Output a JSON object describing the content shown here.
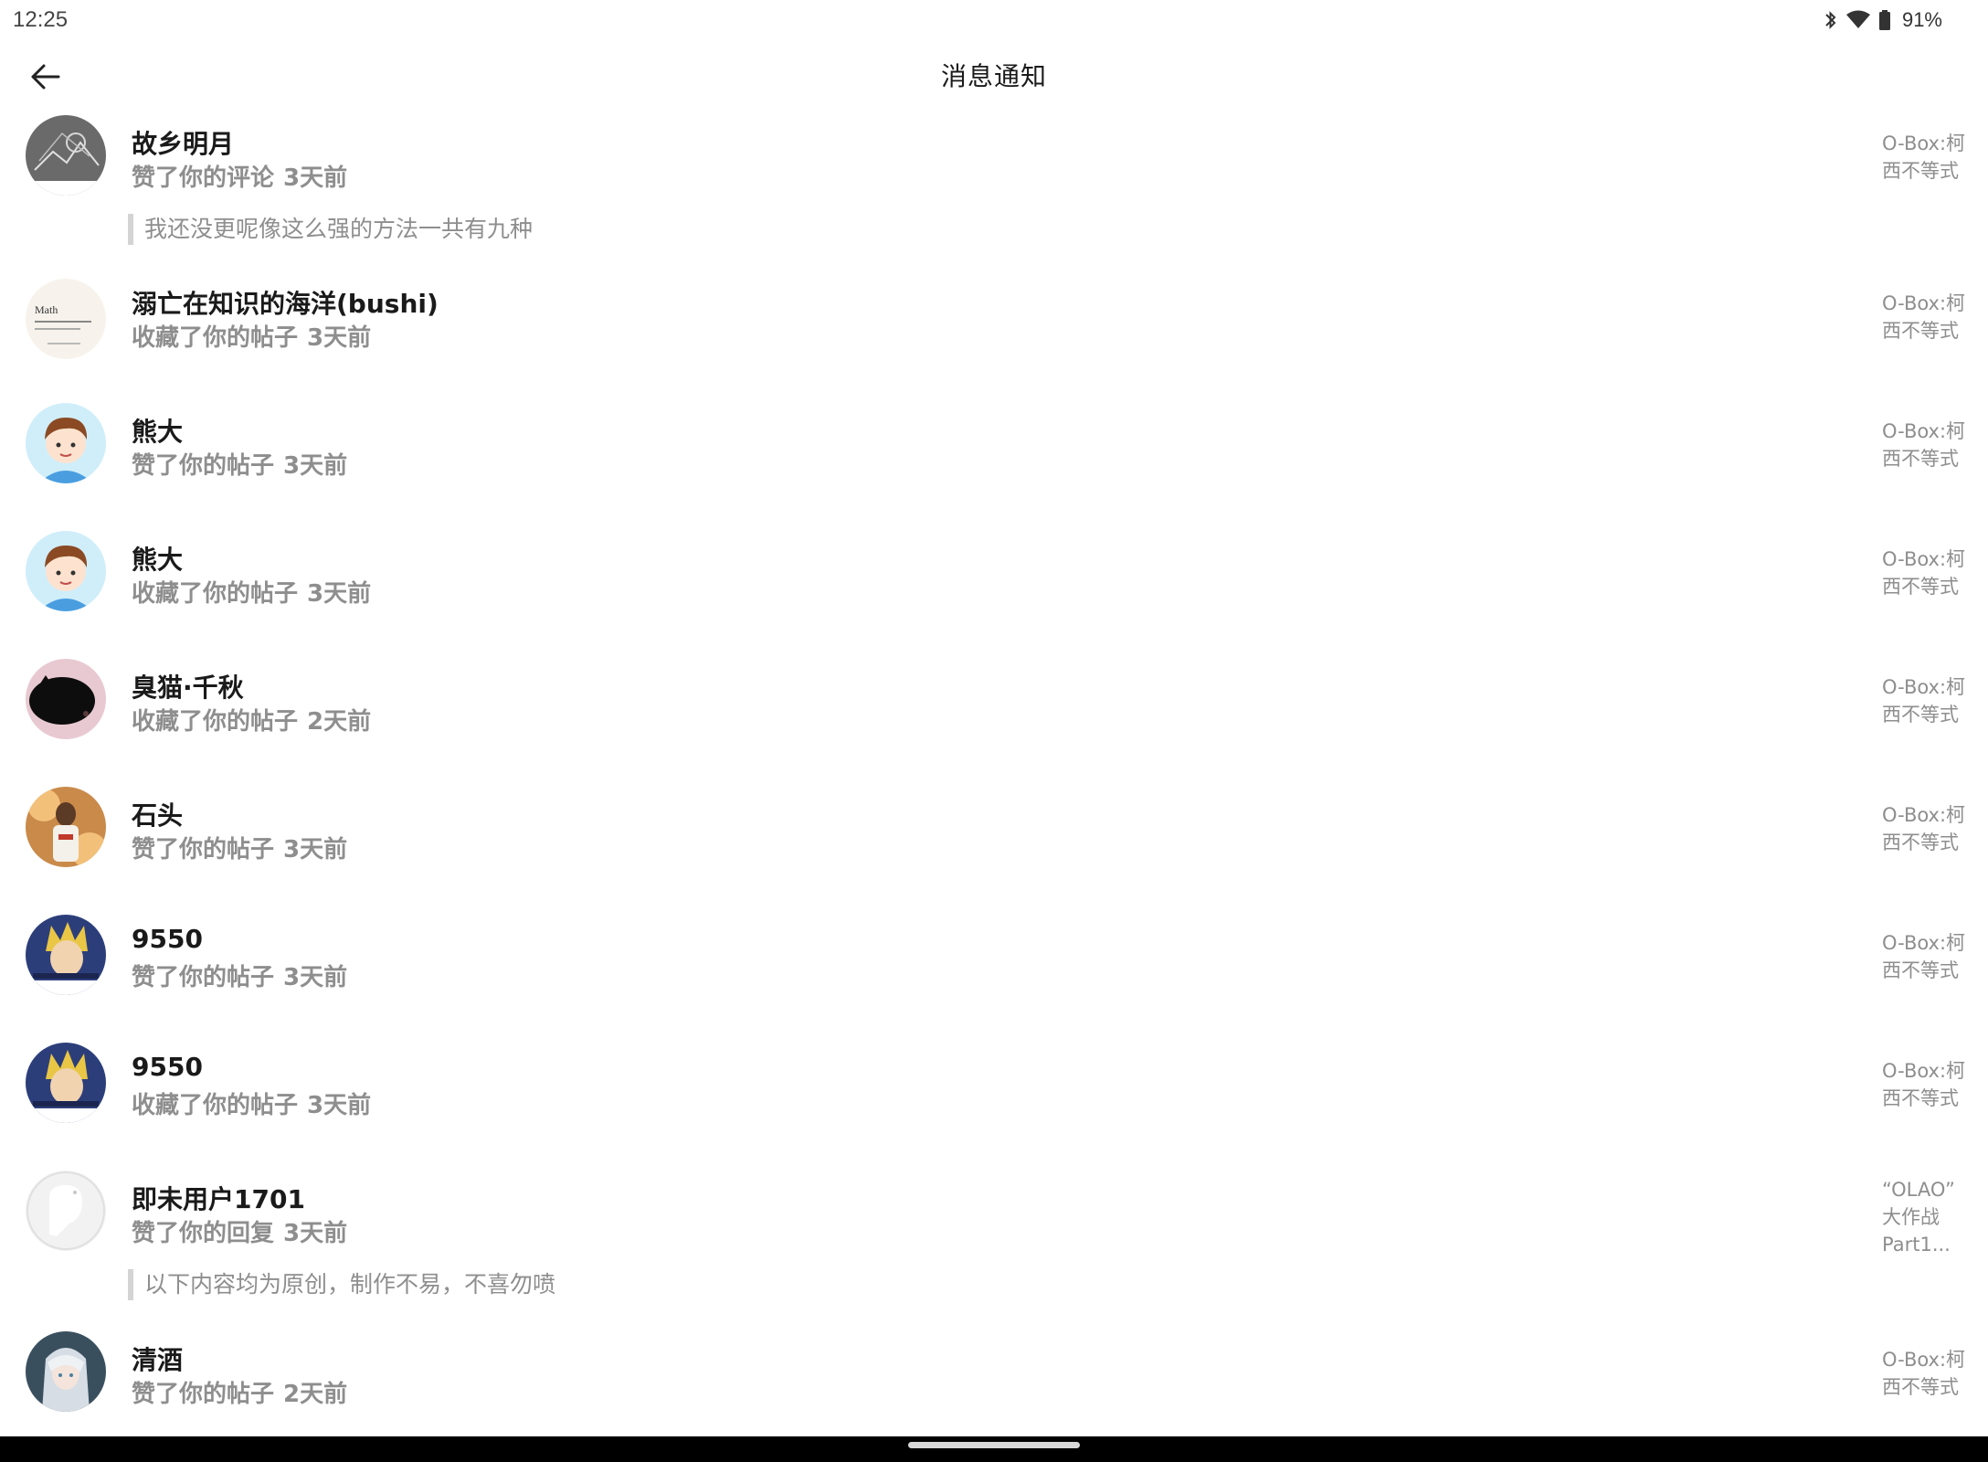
{
  "status_bar": {
    "time": "12:25",
    "battery": "91%"
  },
  "header": {
    "title": "消息通知"
  },
  "notifications": [
    {
      "name": "故乡明月",
      "action": "赞了你的评论",
      "time": "3天前",
      "quote": "我还没更呢像这么强的方法一共有九种",
      "target": [
        "O-Box:柯",
        "西不等式"
      ],
      "avatar": "sketch-dark"
    },
    {
      "name": "溺亡在知识的海洋(bushi)",
      "action": "收藏了你的帖子",
      "time": "3天前",
      "quote": "",
      "target": [
        "O-Box:柯",
        "西不等式"
      ],
      "avatar": "math-card",
      "avatar_text": "Math"
    },
    {
      "name": "熊大",
      "action": "赞了你的帖子",
      "time": "3天前",
      "quote": "",
      "target": [
        "O-Box:柯",
        "西不等式"
      ],
      "avatar": "cartoon-boy"
    },
    {
      "name": "熊大",
      "action": "收藏了你的帖子",
      "time": "3天前",
      "quote": "",
      "target": [
        "O-Box:柯",
        "西不等式"
      ],
      "avatar": "cartoon-boy"
    },
    {
      "name": "臭猫·千秋",
      "action": "收藏了你的帖子",
      "time": "2天前",
      "quote": "",
      "target": [
        "O-Box:柯",
        "西不等式"
      ],
      "avatar": "black-cat"
    },
    {
      "name": "石头",
      "action": "赞了你的帖子",
      "time": "3天前",
      "quote": "",
      "target": [
        "O-Box:柯",
        "西不等式"
      ],
      "avatar": "basketball"
    },
    {
      "name": "9550",
      "action": "赞了你的帖子",
      "time": "3天前",
      "quote": "",
      "target": [
        "O-Box:柯",
        "西不等式"
      ],
      "avatar": "anime-blond"
    },
    {
      "name": "9550",
      "action": "收藏了你的帖子",
      "time": "3天前",
      "quote": "",
      "target": [
        "O-Box:柯",
        "西不等式"
      ],
      "avatar": "anime-blond"
    },
    {
      "name": "即未用户1701",
      "action": "赞了你的回复",
      "time": "3天前",
      "quote": "以下内容均为原创，制作不易，不喜勿喷",
      "target": [
        "“OLAO”",
        "大作战",
        "Part1..."
      ],
      "avatar": "blank-ghost"
    },
    {
      "name": "清酒",
      "action": "赞了你的帖子",
      "time": "2天前",
      "quote": "",
      "target": [
        "O-Box:柯",
        "西不等式"
      ],
      "avatar": "anime-silver"
    }
  ]
}
